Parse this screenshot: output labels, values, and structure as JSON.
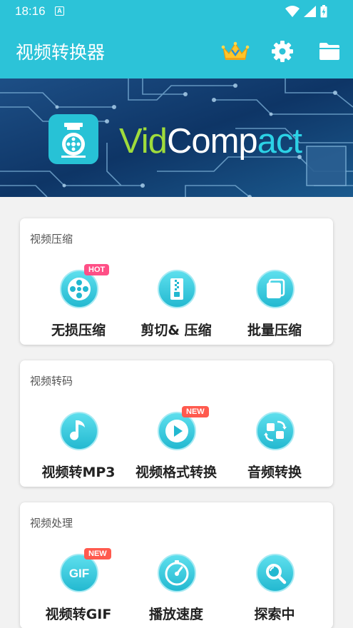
{
  "status_bar": {
    "time": "18:16",
    "notification_letter": "A"
  },
  "app_bar": {
    "title": "视频转换器",
    "icons": [
      "crown-icon",
      "gear-icon",
      "folder-icon"
    ]
  },
  "banner": {
    "name_part1": "Vid",
    "name_part2": "Comp",
    "name_part3": "act"
  },
  "sections": [
    {
      "title": "视频压缩",
      "items": [
        {
          "label": "无损压缩",
          "icon": "film-reel-icon",
          "badge": "HOT"
        },
        {
          "label": "剪切& 压缩",
          "icon": "zip-archive-icon",
          "badge": ""
        },
        {
          "label": "批量压缩",
          "icon": "stacked-pages-icon",
          "badge": ""
        }
      ]
    },
    {
      "title": "视频转码",
      "items": [
        {
          "label": "视频转MP3",
          "icon": "music-note-icon",
          "badge": ""
        },
        {
          "label": "视频格式转换",
          "icon": "play-icon",
          "badge": "NEW"
        },
        {
          "label": "音频转换",
          "icon": "swap-arrows-icon",
          "badge": ""
        }
      ]
    },
    {
      "title": "视频处理",
      "items": [
        {
          "label": "视频转GIF",
          "icon": "gif-icon",
          "badge": "NEW",
          "icon_text": "GIF"
        },
        {
          "label": "播放速度",
          "icon": "speedometer-icon",
          "badge": ""
        },
        {
          "label": "探索中",
          "icon": "magnifier-icon",
          "badge": ""
        }
      ]
    }
  ],
  "colors": {
    "primary": "#2cc3d8",
    "badge_hot": "#ff4f86",
    "badge_new": "#ff5a4e",
    "icon_gradient_top": "#5fe0ee",
    "icon_gradient_bottom": "#22b8d0"
  }
}
